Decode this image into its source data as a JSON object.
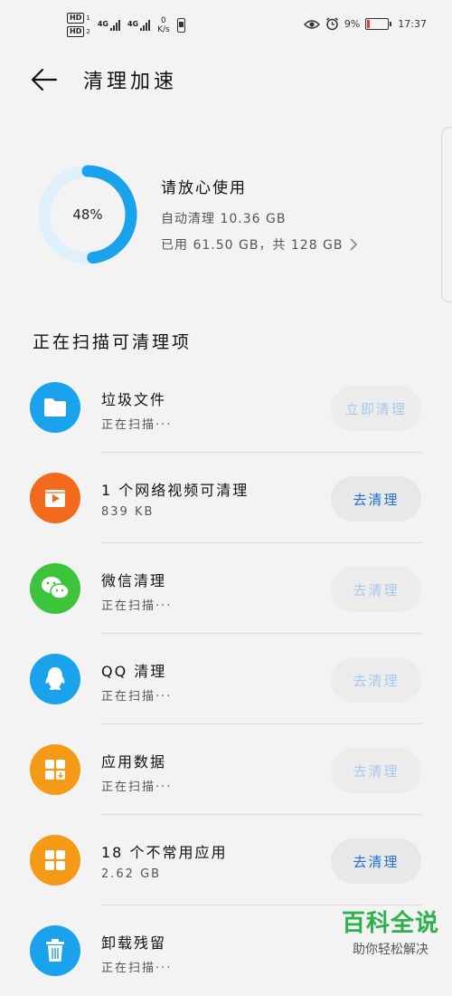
{
  "status_bar": {
    "hd_badge": "HD",
    "sim1": "1",
    "sim2": "2",
    "net1": "4G",
    "net2": "4G",
    "speed_value": "0",
    "speed_unit": "K/s",
    "battery_percent": "9%",
    "time": "17:37"
  },
  "header": {
    "title": "清理加速"
  },
  "storage": {
    "used_percent": 48,
    "percent_label": "48%",
    "status": "请放心使用",
    "auto_clean": "自动清理 10.36 GB",
    "usage": "已用 61.50 GB，共 128 GB"
  },
  "section_title": "正在扫描可清理项",
  "items": [
    {
      "name": "垃圾文件",
      "sub": "正在扫描···",
      "button": "立即清理",
      "enabled": false,
      "color": "#1aa3ec",
      "icon": "folder-icon"
    },
    {
      "name": "1 个网络视频可清理",
      "sub": "839 KB",
      "button": "去清理",
      "enabled": true,
      "color": "#f26b1d",
      "icon": "video-icon"
    },
    {
      "name": "微信清理",
      "sub": "正在扫描···",
      "button": "去清理",
      "enabled": false,
      "color": "#3dc43d",
      "icon": "wechat-icon"
    },
    {
      "name": "QQ 清理",
      "sub": "正在扫描···",
      "button": "去清理",
      "enabled": false,
      "color": "#1aa3ec",
      "icon": "qq-icon"
    },
    {
      "name": "应用数据",
      "sub": "正在扫描···",
      "button": "去清理",
      "enabled": false,
      "color": "#f49a16",
      "icon": "app-data-icon"
    },
    {
      "name": "18 个不常用应用",
      "sub": "2.62 GB",
      "button": "去清理",
      "enabled": true,
      "color": "#f49a16",
      "icon": "apps-grid-icon"
    },
    {
      "name": "卸载残留",
      "sub": "正在扫描···",
      "button": "",
      "enabled": false,
      "color": "#1aa3ec",
      "icon": "trash-icon"
    }
  ],
  "watermark": {
    "line1": "百科全说",
    "line2": "助你轻松解决"
  },
  "colors": {
    "ring": "#1aa3ec",
    "ring_track": "#dff0fa",
    "accent": "#1e6fd8"
  }
}
